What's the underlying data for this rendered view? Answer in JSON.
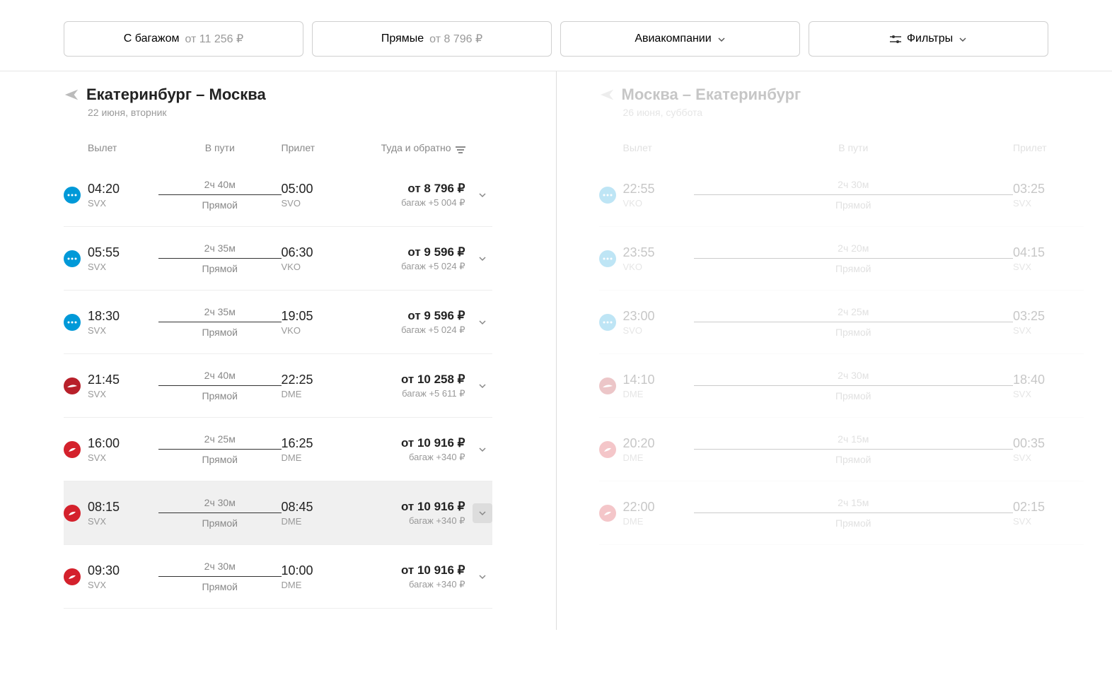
{
  "filters": {
    "baggage_label": "С багажом",
    "baggage_price": "от 11 256 ₽",
    "direct_label": "Прямые",
    "direct_price": "от 8 796 ₽",
    "airlines_label": "Авиакомпании",
    "filters_label": "Фильтры"
  },
  "left": {
    "route": "Екатеринбург – Москва",
    "date": "22 июня, вторник",
    "cols": {
      "dep": "Вылет",
      "dur": "В пути",
      "arr": "Прилет",
      "price": "Туда и обратно"
    },
    "flights": [
      {
        "al": "blue",
        "dep_t": "04:20",
        "dep_c": "SVX",
        "dur": "2ч 40м",
        "type": "Прямой",
        "arr_t": "05:00",
        "arr_c": "SVO",
        "price": "от 8 796 ₽",
        "bag": "багаж +5 004 ₽"
      },
      {
        "al": "blue",
        "dep_t": "05:55",
        "dep_c": "SVX",
        "dur": "2ч 35м",
        "type": "Прямой",
        "arr_t": "06:30",
        "arr_c": "VKO",
        "price": "от 9 596 ₽",
        "bag": "багаж +5 024 ₽"
      },
      {
        "al": "blue",
        "dep_t": "18:30",
        "dep_c": "SVX",
        "dur": "2ч 35м",
        "type": "Прямой",
        "arr_t": "19:05",
        "arr_c": "VKO",
        "price": "от 9 596 ₽",
        "bag": "багаж +5 024 ₽"
      },
      {
        "al": "darkred",
        "dep_t": "21:45",
        "dep_c": "SVX",
        "dur": "2ч 40м",
        "type": "Прямой",
        "arr_t": "22:25",
        "arr_c": "DME",
        "price": "от 10 258 ₽",
        "bag": "багаж +5 611 ₽"
      },
      {
        "al": "red",
        "dep_t": "16:00",
        "dep_c": "SVX",
        "dur": "2ч 25м",
        "type": "Прямой",
        "arr_t": "16:25",
        "arr_c": "DME",
        "price": "от 10 916 ₽",
        "bag": "багаж +340 ₽"
      },
      {
        "al": "red",
        "dep_t": "08:15",
        "dep_c": "SVX",
        "dur": "2ч 30м",
        "type": "Прямой",
        "arr_t": "08:45",
        "arr_c": "DME",
        "price": "от 10 916 ₽",
        "bag": "багаж +340 ₽",
        "hovered": true
      },
      {
        "al": "red",
        "dep_t": "09:30",
        "dep_c": "SVX",
        "dur": "2ч 30м",
        "type": "Прямой",
        "arr_t": "10:00",
        "arr_c": "DME",
        "price": "от 10 916 ₽",
        "bag": "багаж +340 ₽"
      }
    ]
  },
  "right": {
    "route": "Москва – Екатеринбург",
    "date": "26 июня, суббота",
    "cols": {
      "dep": "Вылет",
      "dur": "В пути",
      "arr": "Прилет"
    },
    "flights": [
      {
        "al": "blue",
        "dep_t": "22:55",
        "dep_c": "VKO",
        "dur": "2ч 30м",
        "type": "Прямой",
        "arr_t": "03:25",
        "arr_c": "SVX"
      },
      {
        "al": "blue",
        "dep_t": "23:55",
        "dep_c": "VKO",
        "dur": "2ч 20м",
        "type": "Прямой",
        "arr_t": "04:15",
        "arr_c": "SVX"
      },
      {
        "al": "blue",
        "dep_t": "23:00",
        "dep_c": "SVO",
        "dur": "2ч 25м",
        "type": "Прямой",
        "arr_t": "03:25",
        "arr_c": "SVX"
      },
      {
        "al": "darkred",
        "dep_t": "14:10",
        "dep_c": "DME",
        "dur": "2ч 30м",
        "type": "Прямой",
        "arr_t": "18:40",
        "arr_c": "SVX"
      },
      {
        "al": "red",
        "dep_t": "20:20",
        "dep_c": "DME",
        "dur": "2ч 15м",
        "type": "Прямой",
        "arr_t": "00:35",
        "arr_c": "SVX"
      },
      {
        "al": "red",
        "dep_t": "22:00",
        "dep_c": "DME",
        "dur": "2ч 15м",
        "type": "Прямой",
        "arr_t": "02:15",
        "arr_c": "SVX"
      }
    ]
  }
}
